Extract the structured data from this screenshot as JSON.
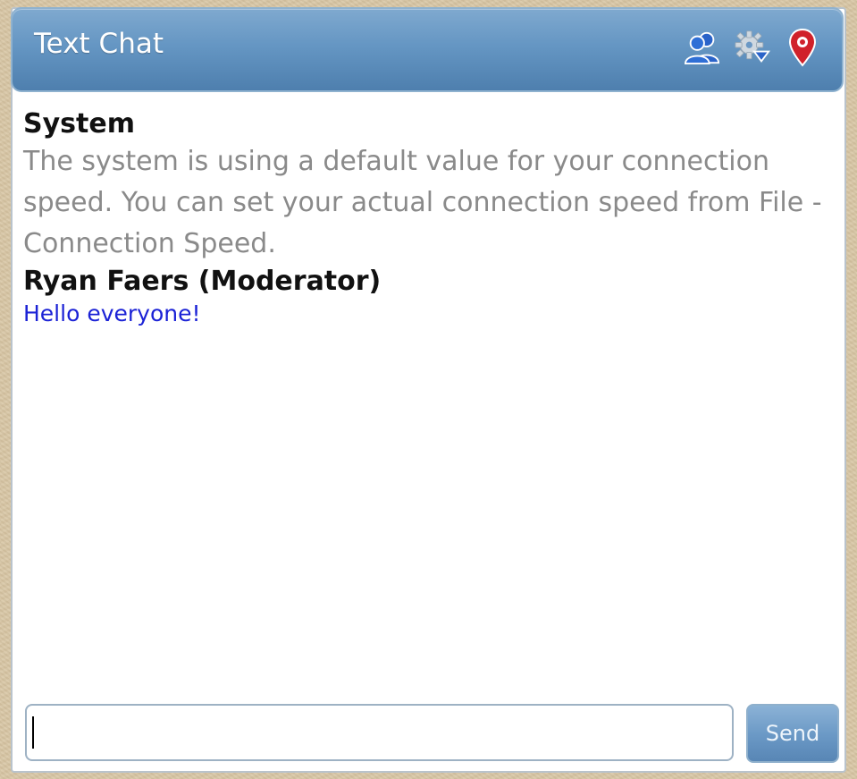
{
  "window": {
    "title": "Text Chat"
  },
  "header_icons": [
    {
      "name": "users-icon",
      "color": "#2a63c9"
    },
    {
      "name": "gear-dropdown-icon",
      "color": "#b9c7d3"
    },
    {
      "name": "location-pin-icon",
      "color": "#d0212a"
    }
  ],
  "messages": [
    {
      "author": "System",
      "text": "The system is using a default value for your connection speed. You can set your actual connection speed from File - Connection Speed.",
      "text_color": "#8a8a8a"
    },
    {
      "author": "Ryan Faers (Moderator)",
      "text": "Hello everyone!",
      "text_color": "#1b22d6"
    }
  ],
  "composer": {
    "input_value": "",
    "send_label": "Send"
  }
}
